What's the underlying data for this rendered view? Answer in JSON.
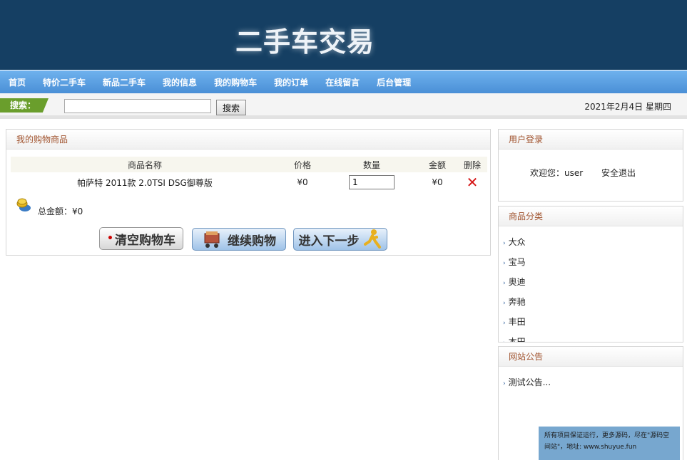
{
  "header": {
    "title": "二手车交易"
  },
  "nav": {
    "items": [
      "首页",
      "特价二手车",
      "新品二手车",
      "我的信息",
      "我的购物车",
      "我的订单",
      "在线留言",
      "后台管理"
    ]
  },
  "search": {
    "label": "搜索：",
    "placeholder": "",
    "value": "",
    "button_label": "搜索",
    "date": "2021年2月4日 星期四"
  },
  "cart": {
    "title": "我的购物商品",
    "columns": [
      "商品名称",
      "价格",
      "数量",
      "金额",
      "删除"
    ],
    "rows": [
      {
        "name": "帕萨特 2011款 2.0TSI DSG御尊版",
        "price": "¥0",
        "quantity": "1",
        "amount": "¥0"
      }
    ],
    "total_label": "总金额：¥0",
    "buttons": {
      "clear": "清空购物车",
      "continue": "继续购物",
      "next": "进入下一步"
    }
  },
  "login": {
    "title": "用户登录",
    "welcome": "欢迎您：user",
    "logout": "安全退出"
  },
  "categories": {
    "title": "商品分类",
    "items": [
      "大众",
      "宝马",
      "奥迪",
      "奔驰",
      "丰田",
      "本田"
    ]
  },
  "notice": {
    "title": "网站公告",
    "items": [
      "测试公告..."
    ]
  },
  "promo": {
    "text": "所有项目保证运行，更多源码，尽在\"源码空间站\"，地址: www.shuyue.fun"
  },
  "colors": {
    "banner": "#153f63",
    "nav": "#4a8fd6",
    "accent": "#a0522d",
    "delete": "#d61818",
    "search_tag": "#6a9e2c"
  }
}
